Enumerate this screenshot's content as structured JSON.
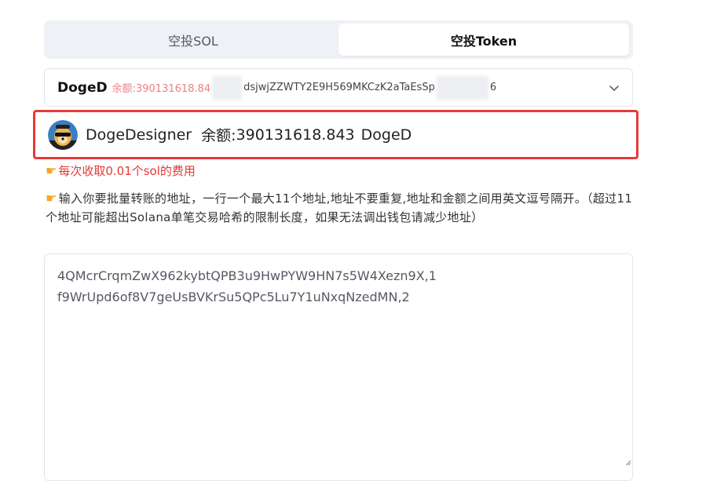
{
  "tabs": [
    {
      "label": "空投SOL",
      "active": false
    },
    {
      "label": "空投Token",
      "active": true
    }
  ],
  "token_select": {
    "symbol": "DogeD",
    "balance_text": "余额:390131618.84",
    "address_visible": "dsjwjZZWTY2E9H569MKCzK2aTaEsSp",
    "address_tail": "6"
  },
  "account": {
    "name": "DogeDesigner",
    "balance_label": "余额:",
    "balance_value": "390131618.843",
    "symbol": "DogeD"
  },
  "fee_note": "每次收取0.01个sol的费用",
  "instruction": "输入你要批量转账的地址，一行一个最大11个地址,地址不要重复,地址和金额之间用英文逗号隔开。（超过11个地址可能超出Solana单笔交易哈希的限制长度，如果无法调出钱包请减少地址）",
  "recipients": [
    "4QMcrCrqmZwX962kybtQPB3u9HwPYW9HN7s5W4Xezn9X,1",
    "f9WrUpd6of8V7geUsBVKrSu5QPc5Lu7Y1uNxqNzedMN,2"
  ],
  "colors": {
    "highlight_border": "#e83a3a",
    "fee_text": "#e53935",
    "balance_text": "#f08080"
  }
}
